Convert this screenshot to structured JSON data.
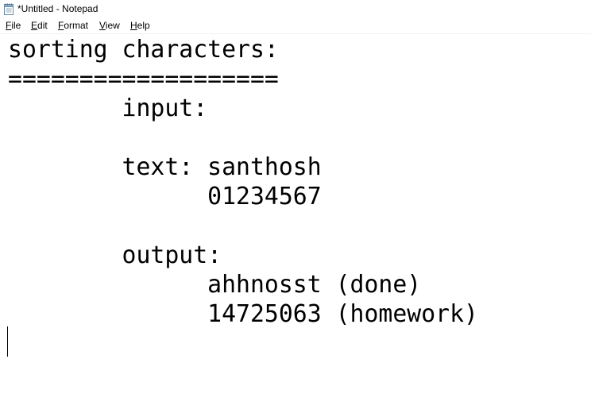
{
  "window": {
    "title": "*Untitled - Notepad",
    "icon": "notepad-icon"
  },
  "menu": {
    "items": [
      {
        "accel": "F",
        "rest": "ile"
      },
      {
        "accel": "E",
        "rest": "dit"
      },
      {
        "accel": "F",
        "rest": "ormat"
      },
      {
        "accel": "V",
        "rest": "iew"
      },
      {
        "accel": "H",
        "rest": "elp"
      }
    ]
  },
  "editor": {
    "lines": [
      "sorting characters:",
      "===================",
      "        input:",
      "",
      "        text: santhosh",
      "              01234567",
      "",
      "        output:",
      "              ahhnosst (done)",
      "              14725063 (homework)",
      ""
    ]
  }
}
